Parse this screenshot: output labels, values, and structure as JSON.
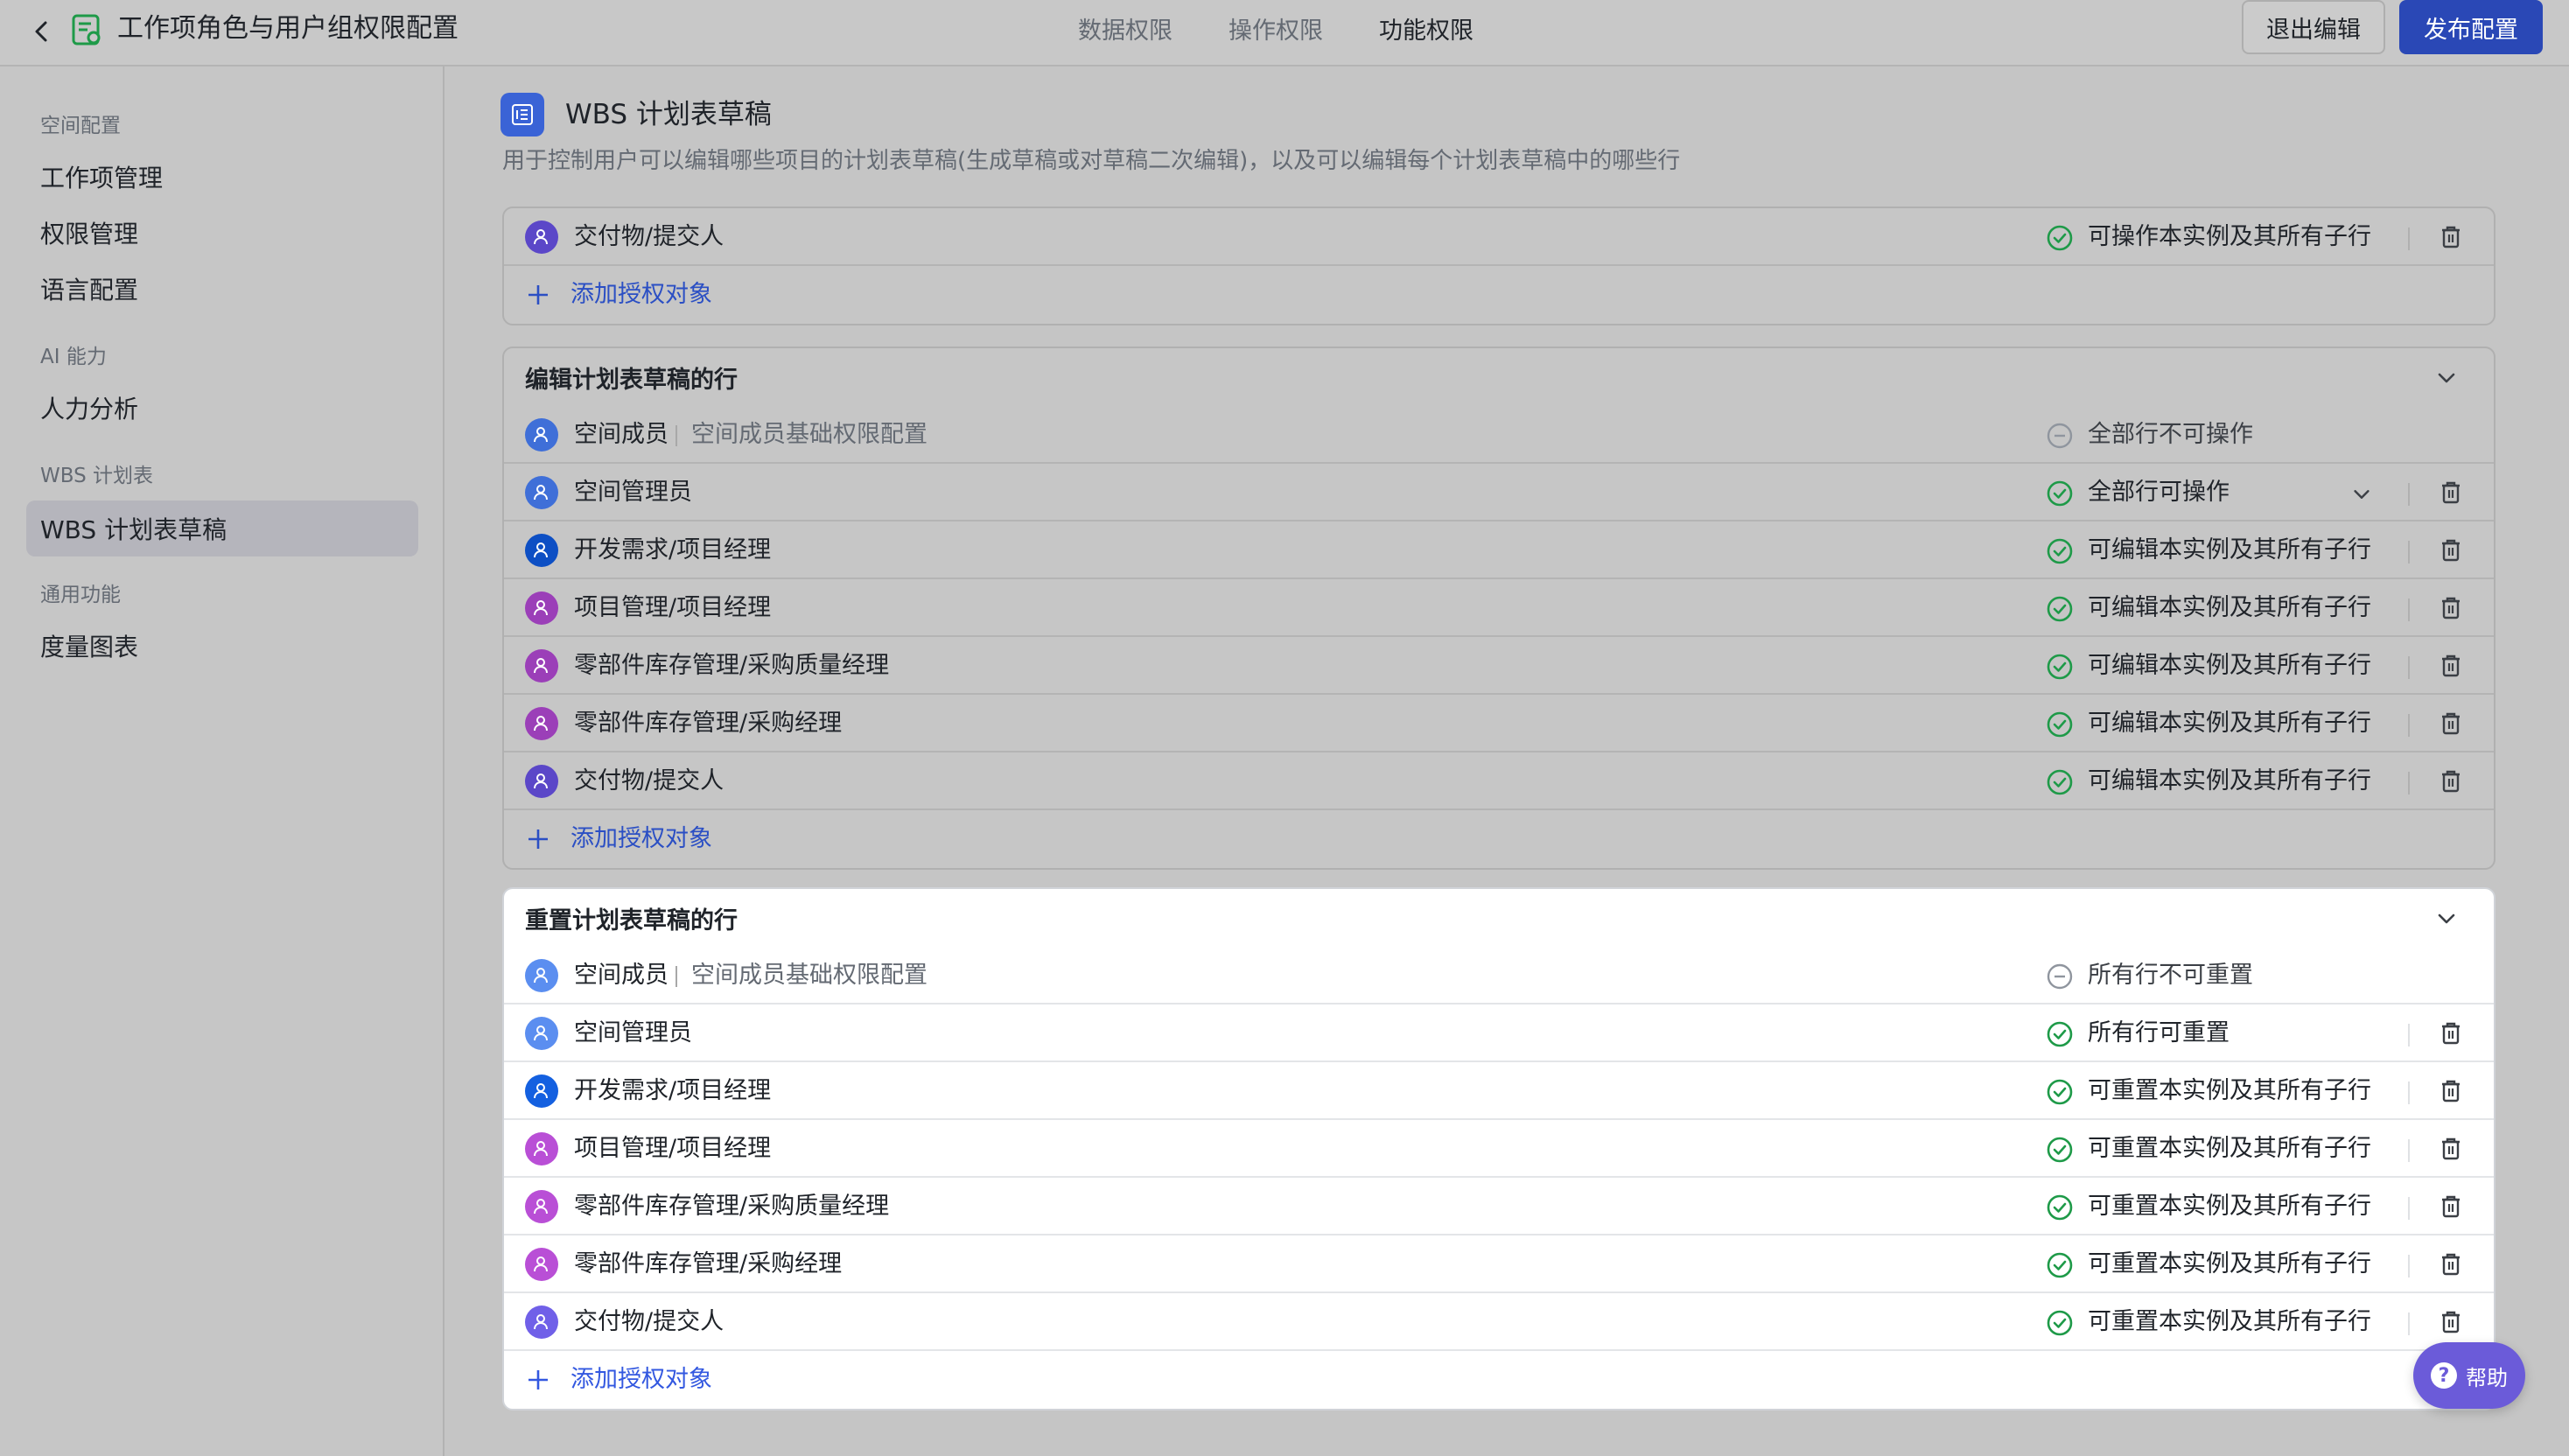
{
  "header": {
    "title": "工作项角色与用户组权限配置",
    "tabs": [
      {
        "label": "数据权限"
      },
      {
        "label": "操作权限"
      },
      {
        "label": "功能权限"
      }
    ],
    "exit_label": "退出编辑",
    "publish_label": "发布配置"
  },
  "sidebar": {
    "groups": [
      {
        "label": "空间配置",
        "items": [
          {
            "label": "工作项管理"
          },
          {
            "label": "权限管理"
          },
          {
            "label": "语言配置"
          }
        ]
      },
      {
        "label": "AI 能力",
        "items": [
          {
            "label": "人力分析"
          }
        ]
      },
      {
        "label": "WBS 计划表",
        "items": [
          {
            "label": "WBS 计划表草稿"
          }
        ]
      },
      {
        "label": "通用功能",
        "items": [
          {
            "label": "度量图表"
          }
        ]
      }
    ]
  },
  "main": {
    "section_title": "WBS 计划表草稿",
    "section_desc": "用于控制用户可以编辑哪些项目的计划表草稿(生成草稿或对草稿二次编辑)，以及可以编辑每个计划表草稿中的哪些行",
    "add_label": "添加授权对象",
    "card1": {
      "rows": [
        {
          "name": "交付物/提交人",
          "status": "可操作本实例及其所有子行"
        }
      ]
    },
    "card2": {
      "title": "编辑计划表草稿的行",
      "rows": [
        {
          "name": "空间成员",
          "sub": "空间成员基础权限配置",
          "status": "全部行不可操作"
        },
        {
          "name": "空间管理员",
          "status": "全部行可操作"
        },
        {
          "name": "开发需求/项目经理",
          "status": "可编辑本实例及其所有子行"
        },
        {
          "name": "项目管理/项目经理",
          "status": "可编辑本实例及其所有子行"
        },
        {
          "name": "零部件库存管理/采购质量经理",
          "status": "可编辑本实例及其所有子行"
        },
        {
          "name": "零部件库存管理/采购经理",
          "status": "可编辑本实例及其所有子行"
        },
        {
          "name": "交付物/提交人",
          "status": "可编辑本实例及其所有子行"
        }
      ]
    },
    "card3": {
      "title": "重置计划表草稿的行",
      "rows": [
        {
          "name": "空间成员",
          "sub": "空间成员基础权限配置",
          "status": "所有行不可重置"
        },
        {
          "name": "空间管理员",
          "status": "所有行可重置"
        },
        {
          "name": "开发需求/项目经理",
          "status": "可重置本实例及其所有子行"
        },
        {
          "name": "项目管理/项目经理",
          "status": "可重置本实例及其所有子行"
        },
        {
          "name": "零部件库存管理/采购质量经理",
          "status": "可重置本实例及其所有子行"
        },
        {
          "name": "零部件库存管理/采购经理",
          "status": "可重置本实例及其所有子行"
        },
        {
          "name": "交付物/提交人",
          "status": "可重置本实例及其所有子行"
        }
      ]
    }
  },
  "help": {
    "label": "帮助",
    "icon": "?"
  },
  "colors": {
    "primary": "#2a48b6",
    "success": "#1e9a48",
    "link": "#2b4fc4"
  }
}
